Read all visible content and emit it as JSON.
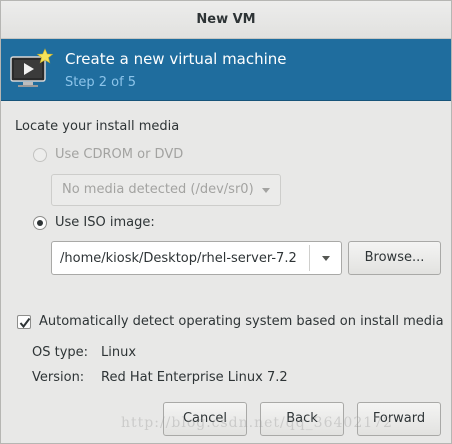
{
  "window": {
    "title": "New VM"
  },
  "banner": {
    "title": "Create a new virtual machine",
    "step": "Step 2 of 5",
    "icon": "virtual-machine-icon"
  },
  "media": {
    "section_label": "Locate your install media",
    "cdrom_label": "Use CDROM or DVD",
    "cdrom_selected": false,
    "cdrom_combo_value": "No media detected (/dev/sr0)",
    "iso_label": "Use ISO image:",
    "iso_selected": true,
    "iso_path": "/home/kiosk/Desktop/rhel-server-7.2",
    "browse_label": "Browse..."
  },
  "os_detect": {
    "checkbox_label": "Automatically detect operating system based on install media",
    "checked": true,
    "os_type_label": "OS type:",
    "os_type_value": "Linux",
    "version_label": "Version:",
    "version_value": "Red Hat Enterprise Linux 7.2"
  },
  "buttons": {
    "cancel": "Cancel",
    "back": "Back",
    "forward": "Forward"
  },
  "watermark": "http://blog.csdn.net/qq_36402172"
}
